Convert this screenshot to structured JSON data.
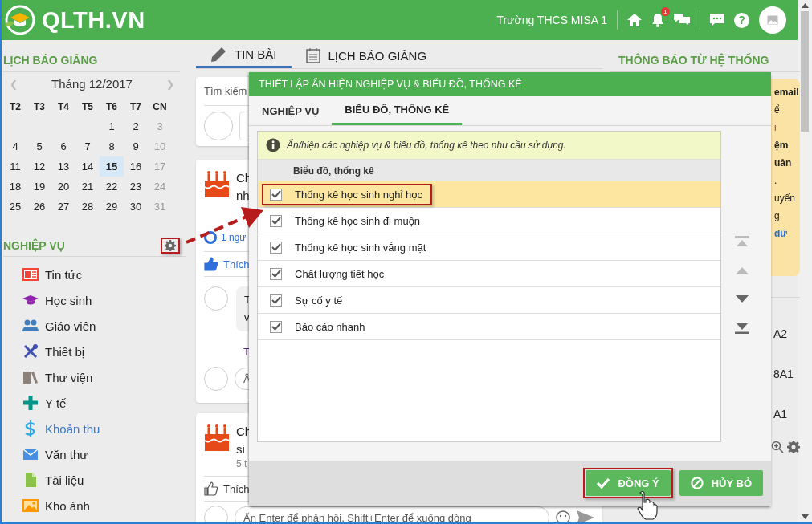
{
  "header": {
    "brand": "QLTH.VN",
    "school": "Trường THCS MISA 1",
    "notification_count": "1",
    "help": "?"
  },
  "sidebar": {
    "calendar": {
      "title": "LỊCH BÁO GIẢNG",
      "prev": "❮",
      "month": "Tháng 12/2017",
      "next": "❯",
      "weekdays": [
        "T2",
        "T3",
        "T4",
        "T5",
        "T6",
        "T7",
        "CN"
      ],
      "weeks": [
        [
          {
            "day": "1",
            "selected": false
          },
          {
            "day": "2",
            "selected": false
          },
          {
            "day": "3",
            "selected": false
          }
        ],
        [
          {
            "day": "4",
            "selected": false
          },
          {
            "day": "5",
            "selected": false
          },
          {
            "day": "6",
            "selected": false
          },
          {
            "day": "7",
            "selected": false
          },
          {
            "day": "8",
            "selected": false
          },
          {
            "day": "9",
            "selected": false
          },
          {
            "day": "10",
            "selected": false
          }
        ],
        [
          {
            "day": "11",
            "selected": false
          },
          {
            "day": "12",
            "selected": false
          },
          {
            "day": "13",
            "selected": false
          },
          {
            "day": "14",
            "selected": false
          },
          {
            "day": "15",
            "selected": true
          },
          {
            "day": "16",
            "selected": false
          },
          {
            "day": "17",
            "selected": false
          }
        ],
        [
          {
            "day": "18",
            "selected": false
          },
          {
            "day": "19",
            "selected": false
          },
          {
            "day": "20",
            "selected": false
          },
          {
            "day": "21",
            "selected": false
          },
          {
            "day": "22",
            "selected": false
          },
          {
            "day": "23",
            "selected": false
          },
          {
            "day": "24",
            "selected": false
          }
        ],
        [
          {
            "day": "25",
            "selected": false
          },
          {
            "day": "26",
            "selected": false
          },
          {
            "day": "27",
            "selected": false
          },
          {
            "day": "28",
            "selected": false
          },
          {
            "day": "29",
            "selected": false
          },
          {
            "day": "30",
            "selected": false
          },
          {
            "day": "31",
            "selected": false
          }
        ]
      ]
    },
    "menu": {
      "title": "NGHIỆP VỤ",
      "items": [
        {
          "label": "Tin tức",
          "selected": false
        },
        {
          "label": "Học sinh",
          "selected": false
        },
        {
          "label": "Giáo viên",
          "selected": false
        },
        {
          "label": "Thiết bị",
          "selected": false
        },
        {
          "label": "Thư viện",
          "selected": false
        },
        {
          "label": "Y tế",
          "selected": false
        },
        {
          "label": "Khoản thu",
          "selected": true
        },
        {
          "label": "Văn thư",
          "selected": false
        },
        {
          "label": "Tài liệu",
          "selected": false
        },
        {
          "label": "Kho ảnh",
          "selected": false
        }
      ]
    }
  },
  "feed": {
    "tabs": [
      {
        "label": "TIN BÀI",
        "selected": true
      },
      {
        "label": "LỊCH BÁO GIẢNG",
        "selected": false
      }
    ],
    "search_placeholder": "Tìm kiếm",
    "posts": [
      {
        "title": [
          "Ch",
          "nh"
        ],
        "reactions": "1 ngư",
        "like": {
          "label": "Thích",
          "liked": true
        },
        "comment": [
          "T",
          "v"
        ],
        "reply": "T",
        "input_placeholder": "Â"
      },
      {
        "title": [
          "Ch",
          "si"
        ],
        "time": "5 t",
        "like": {
          "label": "Thích",
          "liked": false
        },
        "input_placeholder": "Ấn Enter để phản hồi, Shift+Enter để xuống dòng"
      }
    ]
  },
  "notices": {
    "title": "THÔNG BÁO TỪ HỆ THỐNG",
    "card_lines": [
      {
        "text": "email",
        "kind": "bold"
      },
      {
        "text": "ể",
        "kind": "plain"
      },
      {
        "text": "i",
        "kind": "alert"
      },
      {
        "text": "ệm",
        "kind": "bold"
      },
      {
        "text": "uản",
        "kind": "bold"
      },
      {
        "text": ".",
        "kind": "plain"
      },
      {
        "text": "uyển",
        "kind": "plain"
      },
      {
        "text": "g",
        "kind": "plain"
      },
      {
        "text": "dữ",
        "kind": "link"
      }
    ],
    "items": [
      "A2",
      "8A1",
      "A1"
    ]
  },
  "dialog": {
    "title": "THIẾT LẬP ẨN HIỆN NGHIỆP VỤ & BIỂU ĐỒ, THỐNG KÊ",
    "tabs": [
      {
        "label": "NGHIỆP VỤ",
        "selected": false
      },
      {
        "label": "BIỂU ĐỒ, THỐNG KÊ",
        "selected": true
      }
    ],
    "info": "Ẩn/hiện các nghiệp vụ & biểu đồ, thống kê theo nhu cầu sử dụng.",
    "column": "Biểu đồ, thống kê",
    "rows": [
      {
        "label": "Thống kê học sinh nghỉ học",
        "checked": true,
        "selected": true
      },
      {
        "label": "Thống kê học sinh đi muộn",
        "checked": true,
        "selected": false
      },
      {
        "label": "Thống kê học sinh vắng mặt",
        "checked": true,
        "selected": false
      },
      {
        "label": "Chất lượng tiết học",
        "checked": true,
        "selected": false
      },
      {
        "label": "Sự cố y tế",
        "checked": true,
        "selected": false
      },
      {
        "label": "Báo cáo nhanh",
        "checked": true,
        "selected": false
      }
    ],
    "move_buttons": [
      {
        "disabled": true
      },
      {
        "disabled": true
      },
      {
        "disabled": false
      },
      {
        "disabled": false
      }
    ],
    "buttons": [
      {
        "label": "ĐỒNG Ý",
        "kind": "ok"
      },
      {
        "label": "HỦY BỎ",
        "kind": "cancel"
      }
    ]
  }
}
